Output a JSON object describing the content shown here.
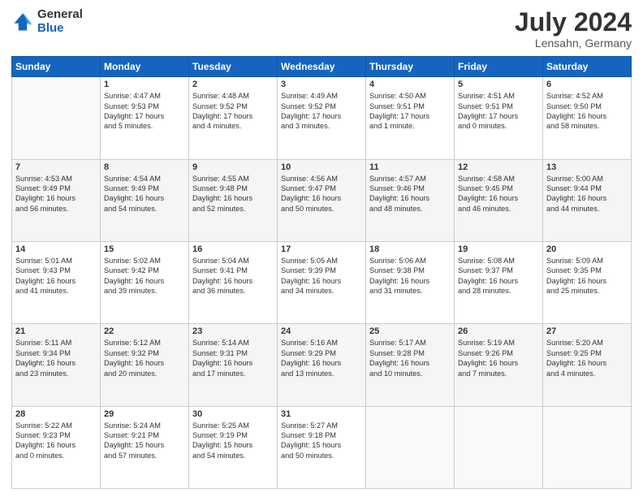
{
  "header": {
    "logo_general": "General",
    "logo_blue": "Blue",
    "month_year": "July 2024",
    "location": "Lensahn, Germany"
  },
  "days_of_week": [
    "Sunday",
    "Monday",
    "Tuesday",
    "Wednesday",
    "Thursday",
    "Friday",
    "Saturday"
  ],
  "weeks": [
    [
      {
        "day": "",
        "text": ""
      },
      {
        "day": "1",
        "text": "Sunrise: 4:47 AM\nSunset: 9:53 PM\nDaylight: 17 hours\nand 5 minutes."
      },
      {
        "day": "2",
        "text": "Sunrise: 4:48 AM\nSunset: 9:52 PM\nDaylight: 17 hours\nand 4 minutes."
      },
      {
        "day": "3",
        "text": "Sunrise: 4:49 AM\nSunset: 9:52 PM\nDaylight: 17 hours\nand 3 minutes."
      },
      {
        "day": "4",
        "text": "Sunrise: 4:50 AM\nSunset: 9:51 PM\nDaylight: 17 hours\nand 1 minute."
      },
      {
        "day": "5",
        "text": "Sunrise: 4:51 AM\nSunset: 9:51 PM\nDaylight: 17 hours\nand 0 minutes."
      },
      {
        "day": "6",
        "text": "Sunrise: 4:52 AM\nSunset: 9:50 PM\nDaylight: 16 hours\nand 58 minutes."
      }
    ],
    [
      {
        "day": "7",
        "text": "Sunrise: 4:53 AM\nSunset: 9:49 PM\nDaylight: 16 hours\nand 56 minutes."
      },
      {
        "day": "8",
        "text": "Sunrise: 4:54 AM\nSunset: 9:49 PM\nDaylight: 16 hours\nand 54 minutes."
      },
      {
        "day": "9",
        "text": "Sunrise: 4:55 AM\nSunset: 9:48 PM\nDaylight: 16 hours\nand 52 minutes."
      },
      {
        "day": "10",
        "text": "Sunrise: 4:56 AM\nSunset: 9:47 PM\nDaylight: 16 hours\nand 50 minutes."
      },
      {
        "day": "11",
        "text": "Sunrise: 4:57 AM\nSunset: 9:46 PM\nDaylight: 16 hours\nand 48 minutes."
      },
      {
        "day": "12",
        "text": "Sunrise: 4:58 AM\nSunset: 9:45 PM\nDaylight: 16 hours\nand 46 minutes."
      },
      {
        "day": "13",
        "text": "Sunrise: 5:00 AM\nSunset: 9:44 PM\nDaylight: 16 hours\nand 44 minutes."
      }
    ],
    [
      {
        "day": "14",
        "text": "Sunrise: 5:01 AM\nSunset: 9:43 PM\nDaylight: 16 hours\nand 41 minutes."
      },
      {
        "day": "15",
        "text": "Sunrise: 5:02 AM\nSunset: 9:42 PM\nDaylight: 16 hours\nand 39 minutes."
      },
      {
        "day": "16",
        "text": "Sunrise: 5:04 AM\nSunset: 9:41 PM\nDaylight: 16 hours\nand 36 minutes."
      },
      {
        "day": "17",
        "text": "Sunrise: 5:05 AM\nSunset: 9:39 PM\nDaylight: 16 hours\nand 34 minutes."
      },
      {
        "day": "18",
        "text": "Sunrise: 5:06 AM\nSunset: 9:38 PM\nDaylight: 16 hours\nand 31 minutes."
      },
      {
        "day": "19",
        "text": "Sunrise: 5:08 AM\nSunset: 9:37 PM\nDaylight: 16 hours\nand 28 minutes."
      },
      {
        "day": "20",
        "text": "Sunrise: 5:09 AM\nSunset: 9:35 PM\nDaylight: 16 hours\nand 25 minutes."
      }
    ],
    [
      {
        "day": "21",
        "text": "Sunrise: 5:11 AM\nSunset: 9:34 PM\nDaylight: 16 hours\nand 23 minutes."
      },
      {
        "day": "22",
        "text": "Sunrise: 5:12 AM\nSunset: 9:32 PM\nDaylight: 16 hours\nand 20 minutes."
      },
      {
        "day": "23",
        "text": "Sunrise: 5:14 AM\nSunset: 9:31 PM\nDaylight: 16 hours\nand 17 minutes."
      },
      {
        "day": "24",
        "text": "Sunrise: 5:16 AM\nSunset: 9:29 PM\nDaylight: 16 hours\nand 13 minutes."
      },
      {
        "day": "25",
        "text": "Sunrise: 5:17 AM\nSunset: 9:28 PM\nDaylight: 16 hours\nand 10 minutes."
      },
      {
        "day": "26",
        "text": "Sunrise: 5:19 AM\nSunset: 9:26 PM\nDaylight: 16 hours\nand 7 minutes."
      },
      {
        "day": "27",
        "text": "Sunrise: 5:20 AM\nSunset: 9:25 PM\nDaylight: 16 hours\nand 4 minutes."
      }
    ],
    [
      {
        "day": "28",
        "text": "Sunrise: 5:22 AM\nSunset: 9:23 PM\nDaylight: 16 hours\nand 0 minutes."
      },
      {
        "day": "29",
        "text": "Sunrise: 5:24 AM\nSunset: 9:21 PM\nDaylight: 15 hours\nand 57 minutes."
      },
      {
        "day": "30",
        "text": "Sunrise: 5:25 AM\nSunset: 9:19 PM\nDaylight: 15 hours\nand 54 minutes."
      },
      {
        "day": "31",
        "text": "Sunrise: 5:27 AM\nSunset: 9:18 PM\nDaylight: 15 hours\nand 50 minutes."
      },
      {
        "day": "",
        "text": ""
      },
      {
        "day": "",
        "text": ""
      },
      {
        "day": "",
        "text": ""
      }
    ]
  ]
}
